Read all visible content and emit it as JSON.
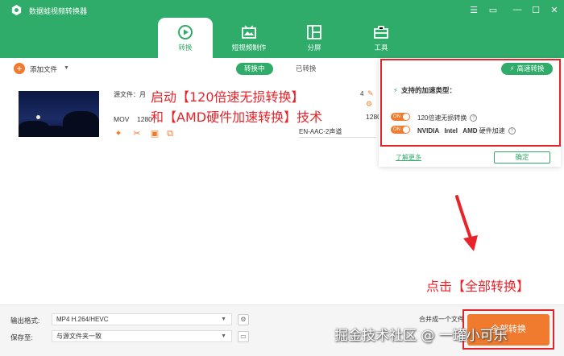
{
  "window": {
    "title": "数据蛙视频转换器",
    "controls": [
      "menu-icon",
      "feedback-icon",
      "minimize-icon",
      "maximize-icon",
      "close-icon"
    ]
  },
  "nav": {
    "tabs": [
      {
        "label": "转换",
        "icon": "convert-icon",
        "active": true
      },
      {
        "label": "短视频制作",
        "icon": "video-maker-icon",
        "active": false
      },
      {
        "label": "分屏",
        "icon": "split-screen-icon",
        "active": false
      },
      {
        "label": "工具",
        "icon": "toolbox-icon",
        "active": false
      }
    ]
  },
  "toolbar": {
    "add_file": "添加文件",
    "status_tabs": [
      "转换中",
      "已转换"
    ]
  },
  "file": {
    "source_label": "源文件：月",
    "format": "MOV",
    "resolution": "1280",
    "dst_resolution": "1280",
    "dst_count": "4",
    "audio": "EN-AAC-2声道"
  },
  "annotations": {
    "line1": "启动【120倍速无损转换】",
    "line2": "和【AMD硬件加速转换】技术",
    "click_hint": "点击【全部转换】"
  },
  "popup": {
    "button": "高速转换",
    "title": "支持的加速类型：",
    "option1": "120倍速无损转换",
    "option2_brands": "NVIDIA   Intel   AMD",
    "option2_suffix": "硬件加速",
    "toggle_text": "ON",
    "learn_more": "了解更多",
    "confirm": "确定"
  },
  "bottom": {
    "format_label": "输出格式:",
    "format_value": "MP4 H.264/HEVC",
    "save_label": "保存至:",
    "save_value": "与源文件夹一致",
    "merge_label": "合并成一个文件",
    "convert_button": "全部转换"
  },
  "watermark": "掘金技术社区 @ 一罐小可乐",
  "colors": {
    "brand_green": "#2fab6a",
    "accent_orange": "#f07a2e",
    "annotation_red": "#e8242a"
  }
}
